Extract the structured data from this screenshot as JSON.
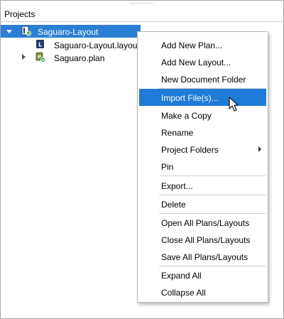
{
  "panel": {
    "title": "Projects"
  },
  "tree": {
    "root": {
      "label": "Saguaro-Layout",
      "expanded": true,
      "selected": true,
      "icon": "project-icon"
    },
    "children": [
      {
        "label": "Saguaro-Layout.layout",
        "icon": "layout-file-icon"
      },
      {
        "label": "Saguaro.plan",
        "icon": "plan-file-icon",
        "expandable": true
      }
    ]
  },
  "context_menu": {
    "items": [
      {
        "label": "Add New Plan..."
      },
      {
        "label": "Add New Layout..."
      },
      {
        "label": "New Document Folder"
      },
      {
        "label": "Import File(s)...",
        "highlighted": true
      },
      {
        "label": "Make a Copy"
      },
      {
        "label": "Rename"
      },
      {
        "label": "Project Folders",
        "has_submenu": true
      },
      {
        "label": "Pin"
      },
      {
        "label": "Export..."
      },
      {
        "label": "Delete"
      },
      {
        "label": "Open All Plans/Layouts"
      },
      {
        "label": "Close All Plans/Layouts"
      },
      {
        "label": "Save All Plans/Layouts"
      },
      {
        "label": "Expand All"
      },
      {
        "label": "Collapse All"
      }
    ]
  },
  "colors": {
    "selection": "#2a7fd4",
    "menu_highlight": "#1e7bd6",
    "badge_green": "#3aa14a"
  }
}
